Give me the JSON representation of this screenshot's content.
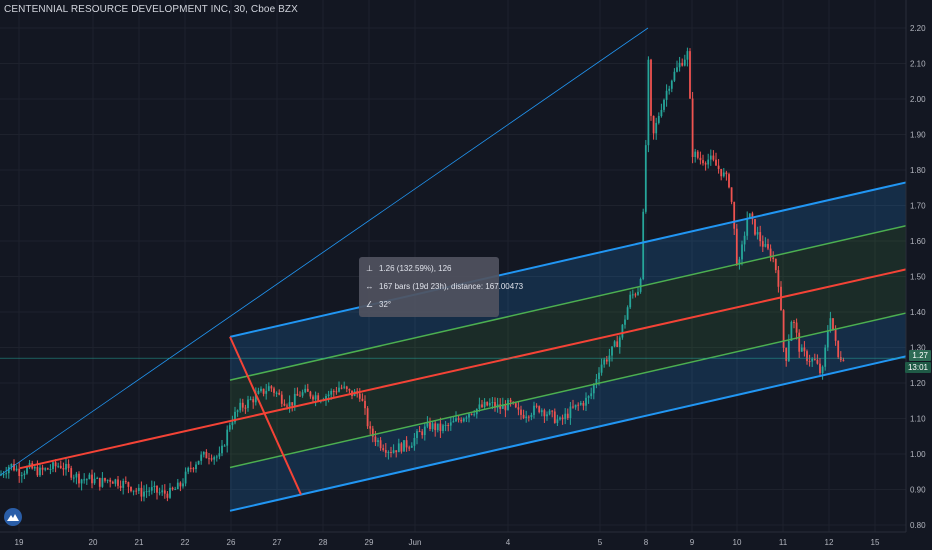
{
  "header": {
    "title": "CENTENNIAL RESOURCE DEVELOPMENT INC, 30, Cboe BZX"
  },
  "measure": {
    "price_line": "1.26 (132.59%), 126",
    "range_line": "167 bars (19d 23h), distance: 167.00473",
    "angle_line": "32°"
  },
  "price_tags": {
    "last_price": "1.27",
    "countdown": "13:01"
  },
  "colors": {
    "background": "#131722",
    "up": "#26a69a",
    "down": "#ef5350",
    "channel_edge": "#2196f3",
    "channel_inner": "#4caf50",
    "median": "#f44336"
  },
  "chart_data": {
    "type": "candlestick",
    "title": "CENTENNIAL RESOURCE DEVELOPMENT INC, 30, Cboe BZX",
    "ylim": [
      0.78,
      2.24
    ],
    "y_ticks": [
      "2.20",
      "2.10",
      "2.00",
      "1.90",
      "1.80",
      "1.70",
      "1.60",
      "1.50",
      "1.40",
      "1.30",
      "1.20",
      "1.10",
      "1.00",
      "0.90",
      "0.80"
    ],
    "x_ticks": [
      "19",
      "20",
      "21",
      "22",
      "26",
      "27",
      "28",
      "29",
      "Jun",
      "4",
      "5",
      "8",
      "9",
      "10",
      "11",
      "12",
      "15"
    ],
    "close_path": [
      [
        0,
        0.94
      ],
      [
        10,
        0.97
      ],
      [
        20,
        0.95
      ],
      [
        30,
        0.96
      ],
      [
        40,
        0.95
      ],
      [
        50,
        0.96
      ],
      [
        60,
        0.97
      ],
      [
        70,
        0.95
      ],
      [
        80,
        0.93
      ],
      [
        90,
        0.93
      ],
      [
        100,
        0.92
      ],
      [
        110,
        0.93
      ],
      [
        120,
        0.92
      ],
      [
        130,
        0.91
      ],
      [
        140,
        0.89
      ],
      [
        150,
        0.9
      ],
      [
        160,
        0.89
      ],
      [
        170,
        0.89
      ],
      [
        180,
        0.91
      ],
      [
        190,
        0.96
      ],
      [
        200,
        0.99
      ],
      [
        210,
        1.0
      ],
      [
        220,
        0.99
      ],
      [
        230,
        1.09
      ],
      [
        240,
        1.13
      ],
      [
        250,
        1.15
      ],
      [
        260,
        1.17
      ],
      [
        270,
        1.19
      ],
      [
        280,
        1.16
      ],
      [
        290,
        1.14
      ],
      [
        300,
        1.17
      ],
      [
        310,
        1.17
      ],
      [
        320,
        1.16
      ],
      [
        330,
        1.17
      ],
      [
        340,
        1.19
      ],
      [
        350,
        1.17
      ],
      [
        360,
        1.17
      ],
      [
        370,
        1.06
      ],
      [
        380,
        1.03
      ],
      [
        390,
        1.01
      ],
      [
        400,
        1.02
      ],
      [
        410,
        1.03
      ],
      [
        420,
        1.06
      ],
      [
        430,
        1.08
      ],
      [
        440,
        1.07
      ],
      [
        450,
        1.08
      ],
      [
        460,
        1.1
      ],
      [
        470,
        1.12
      ],
      [
        480,
        1.13
      ],
      [
        490,
        1.14
      ],
      [
        500,
        1.13
      ],
      [
        510,
        1.14
      ],
      [
        520,
        1.11
      ],
      [
        530,
        1.12
      ],
      [
        540,
        1.13
      ],
      [
        550,
        1.11
      ],
      [
        560,
        1.09
      ],
      [
        570,
        1.12
      ],
      [
        580,
        1.14
      ],
      [
        590,
        1.16
      ],
      [
        600,
        1.25
      ],
      [
        610,
        1.28
      ],
      [
        620,
        1.33
      ],
      [
        630,
        1.44
      ],
      [
        640,
        1.47
      ],
      [
        645,
        1.78
      ],
      [
        648,
        2.12
      ],
      [
        652,
        1.88
      ],
      [
        660,
        1.97
      ],
      [
        670,
        2.05
      ],
      [
        680,
        2.1
      ],
      [
        688,
        2.13
      ],
      [
        692,
        1.85
      ],
      [
        700,
        1.83
      ],
      [
        710,
        1.83
      ],
      [
        720,
        1.8
      ],
      [
        730,
        1.76
      ],
      [
        738,
        1.51
      ],
      [
        748,
        1.68
      ],
      [
        755,
        1.63
      ],
      [
        765,
        1.58
      ],
      [
        772,
        1.56
      ],
      [
        778,
        1.5
      ],
      [
        785,
        1.25
      ],
      [
        792,
        1.39
      ],
      [
        800,
        1.29
      ],
      [
        808,
        1.27
      ],
      [
        815,
        1.26
      ],
      [
        822,
        1.22
      ],
      [
        830,
        1.4
      ],
      [
        838,
        1.27
      ],
      [
        845,
        1.28
      ]
    ],
    "last_price": 1.27,
    "drawings": {
      "trend_line": [
        [
          0,
          0.94
        ],
        [
          648,
          2.2
        ]
      ],
      "regression_channel_x": [
        230,
        906
      ],
      "measure": {
        "price_change": "1.26 (132.59%), 126",
        "bars": "167 bars (19d 23h), distance: 167.00473",
        "angle": "32°"
      }
    }
  }
}
